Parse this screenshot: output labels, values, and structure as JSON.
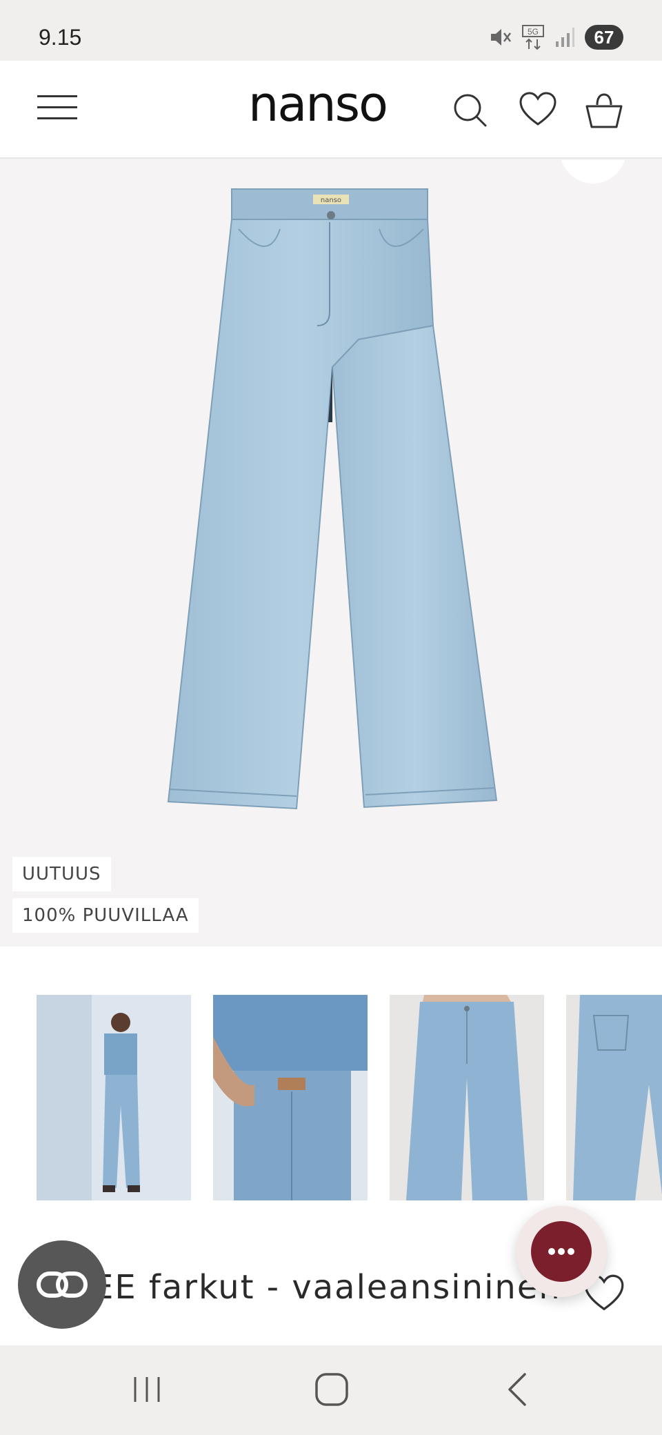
{
  "status_bar": {
    "time": "9.15",
    "battery": "67",
    "icons": [
      "mute-icon",
      "5g-icon",
      "signal-icon",
      "battery-icon"
    ]
  },
  "header": {
    "brand": "nanso",
    "icons": [
      "menu-icon",
      "search-icon",
      "heart-icon",
      "basket-icon"
    ]
  },
  "hero": {
    "badges": [
      "UUTUUS",
      "100% PUUVILLAA"
    ],
    "jeans_label": "nanso"
  },
  "thumbnails": {
    "count_visible": 4
  },
  "product": {
    "title": "EE farkut - vaaleansininen"
  },
  "colors": {
    "denim": "#a9c6dc",
    "chat_accent": "#7a1f2b",
    "hero_bg": "#f5f3f3"
  },
  "nav_bar": {
    "icons": [
      "recent-apps-icon",
      "home-icon",
      "back-icon"
    ]
  }
}
